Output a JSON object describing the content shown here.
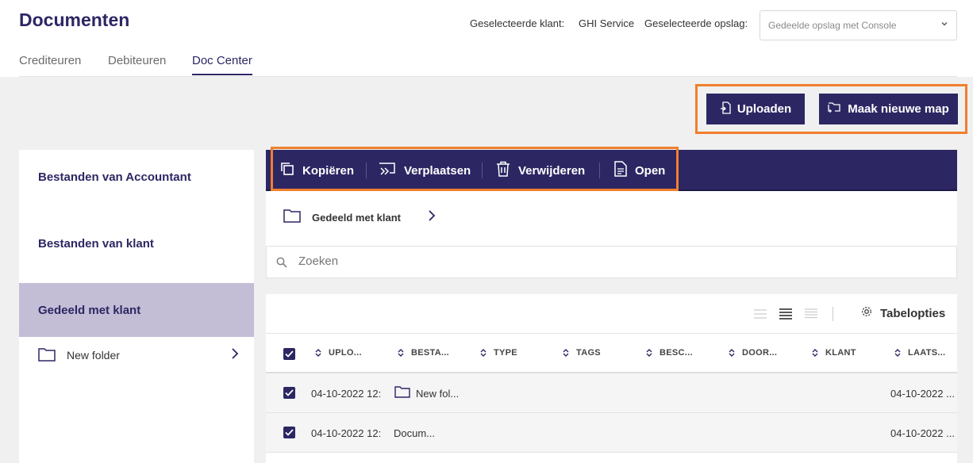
{
  "header": {
    "title": "Documenten",
    "selected_client_label": "Geselecteerde klant:",
    "selected_client": "GHI Service",
    "selected_storage_label": "Geselecteerde opslag:",
    "storage_select_value": "Gedeelde opslag met Console"
  },
  "tabs": [
    "Crediteuren",
    "Debiteuren",
    "Doc Center"
  ],
  "active_tab": "Doc Center",
  "actions": {
    "upload": "Uploaden",
    "new_folder": "Maak nieuwe map"
  },
  "sidebar": {
    "items": [
      "Bestanden van Accountant",
      "Bestanden van klant",
      "Gedeeld met klant"
    ],
    "active": "Gedeeld met klant",
    "folder": "New folder"
  },
  "toolbar": {
    "copy": "Kopiëren",
    "move": "Verplaatsen",
    "delete": "Verwijderen",
    "open": "Open"
  },
  "breadcrumb": "Gedeeld met klant",
  "search": {
    "placeholder": "Zoeken"
  },
  "table_options": "Tabelopties",
  "columns": [
    "UPLO...",
    "BESTA...",
    "TYPE",
    "TAGS",
    "BESC...",
    "DOOR...",
    "KLANT",
    "LAATS..."
  ],
  "rows": [
    {
      "uploaded": "04-10-2022 12:",
      "name": "New fol...",
      "is_folder": true,
      "last": "04-10-2022 ..."
    },
    {
      "uploaded": "04-10-2022 12:",
      "name": "Docum...",
      "is_folder": false,
      "last": "04-10-2022 ..."
    }
  ],
  "colors": {
    "primary": "#2c2763",
    "highlight": "#f07f2e",
    "active_sidebar": "#c3bdd6"
  }
}
